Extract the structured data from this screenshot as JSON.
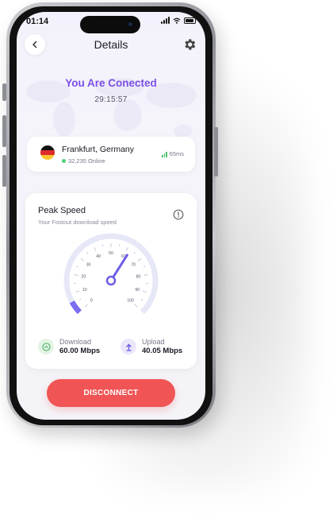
{
  "status_bar": {
    "time": "01:14"
  },
  "header": {
    "title": "Details"
  },
  "connection": {
    "title": "You Are Conected",
    "timer": "29:15:57"
  },
  "server": {
    "name": "Frankfurt, Germany",
    "online": "32,235 Online",
    "ping": "65ms"
  },
  "speed": {
    "title": "Peak Speed",
    "subtitle": "Your Fostout download speed",
    "ticks": [
      "0",
      "10",
      "20",
      "30",
      "40",
      "50",
      "60",
      "70",
      "80",
      "90",
      "100"
    ],
    "needle_value": 62,
    "download_label": "Download",
    "download_value": "60.00 Mbps",
    "upload_label": "Upload",
    "upload_value": "40.05 Mbps"
  },
  "actions": {
    "disconnect_label": "DISCONNECT"
  },
  "colors": {
    "accent": "#7a4fe6",
    "danger": "#f05454",
    "online": "#4cd07a"
  }
}
